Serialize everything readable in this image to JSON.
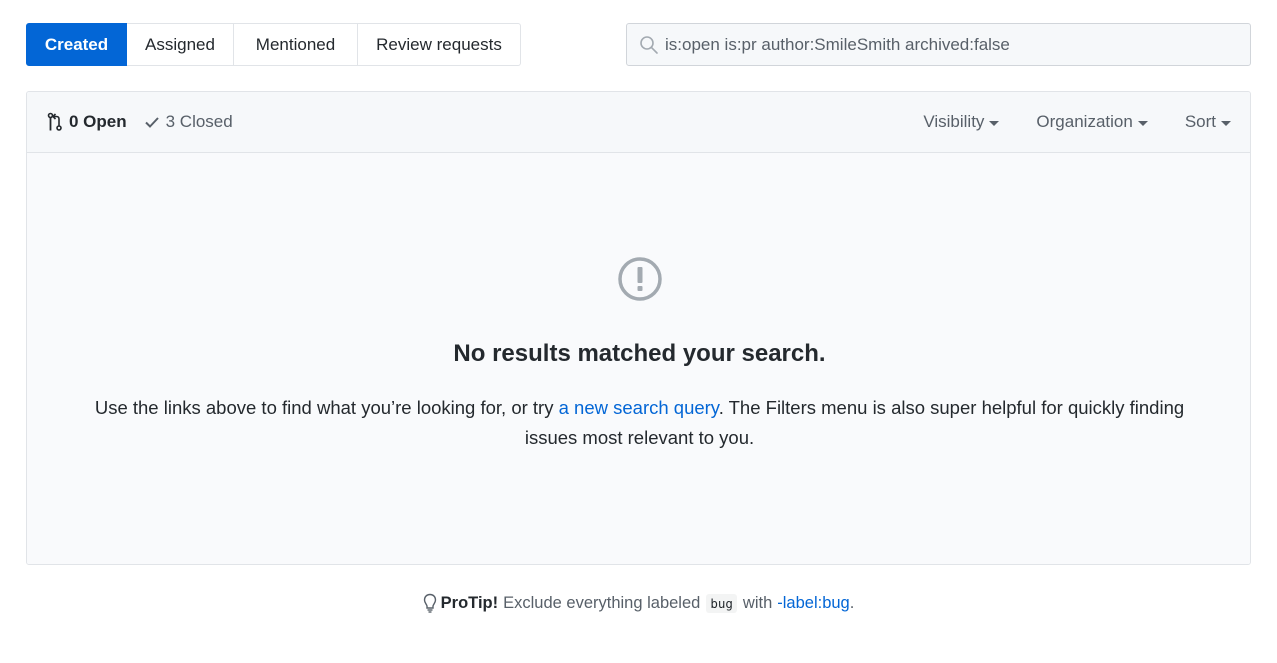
{
  "tabs": [
    {
      "label": "Created",
      "selected": true
    },
    {
      "label": "Assigned",
      "selected": false
    },
    {
      "label": "Mentioned",
      "selected": false
    },
    {
      "label": "Review requests",
      "selected": false
    }
  ],
  "search": {
    "value": "is:open is:pr author:SmileSmith archived:false",
    "icon": "search-icon"
  },
  "states": {
    "open_label": "0 Open",
    "closed_label": "3 Closed"
  },
  "filters": {
    "visibility": "Visibility",
    "organization": "Organization",
    "sort": "Sort"
  },
  "blankslate": {
    "icon": "alert-icon",
    "title": "No results matched your search.",
    "text_before": "Use the links above to find what you’re looking for, or try ",
    "link": "a new search query",
    "text_after": ". The Filters menu is also super helpful for quickly finding issues most relevant to you."
  },
  "protip": {
    "icon": "light-bulb-icon",
    "label": "ProTip!",
    "text_before": "Exclude everything labeled",
    "code": "bug",
    "text_with": "with",
    "link": "-label:bug",
    "period": "."
  },
  "colors": {
    "accent": "#0366d6",
    "text": "#24292e",
    "muted": "#586069",
    "border": "#e1e4e8",
    "panel": "#f6f8fa"
  }
}
